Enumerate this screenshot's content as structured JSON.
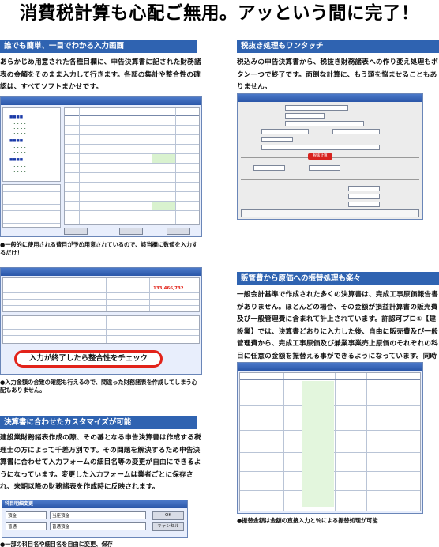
{
  "headline": "消費税計算も心配ご無用。アッという間に完了！",
  "sections": {
    "input": {
      "heading": "誰でも簡単、一目でわかる入力画面",
      "body": "あらかじめ用意された各種目欄に、申告決算書に記された財務諸表の金額をそのまま入力して行きます。各部の集計や整合性の確認は、すべてソフトまかせです。",
      "note": "●一般的に使用される費目が予め用意されているので、該当欄に数値を入力するだけ！"
    },
    "check": {
      "callout": "入力が終了したら整合性をチェック",
      "note": "●入力金額の合致の確認も行えるので、間違った財務諸表を作成してしまう心配もありません。",
      "amount": "133,466,732"
    },
    "customize": {
      "heading": "決算書に合わせたカスタマイズが可能",
      "body": "建設業財務諸表作成の際、その基となる申告決算書は作成する税理士の方によって千差万別です。その問題を解決するため申告決算書に合わせて入力フォームの細目名等の変更が自由にできるようになっています。変更した入力フォームは業者ごとに保存され、来期以降の財務諸表を作成時に反映されます。",
      "note": "●一部の科目名や細目名を自由に変更、保存",
      "dialog_title": "科目明細変更",
      "row1_label": "預金",
      "row1_value": "当座預金",
      "row2_label": "普通",
      "row2_value": "普通預金",
      "ok": "OK",
      "cancel": "キャンセル"
    },
    "tax": {
      "heading": "税抜き処理もワンタッチ",
      "body": "税込みの申告決算書から、税抜き財務諸表への作り変え処理もボタン一つで終了です。面倒な計算に、もう頭を悩ませることもありません。",
      "button": "税抜計算"
    },
    "transfer": {
      "heading": "販管費から原価への振替処理も楽々",
      "body": "一般会計基準で作成された多くの決算書は、完成工事原価報告書がありません。ほとんどの場合、その金額が損益計算書の販売費及び一般管理費に含まれて計上されています。許認可プロ①【建設業】では、決算書どおりに入力した後、自由に販売費及び一般管理費から、完成工事原価及び兼業事業売上原価のそれぞれの科目に任意の金額を振替える事ができるようになっています。同時に相対する科目間同士の金額の相殺処理も行います。",
      "note": "●振替金額は金額の直接入力と％による振替処理が可能"
    }
  },
  "colors": {
    "heading_bar": "#2f63b1",
    "callout_border": "#e2231a",
    "window_title": "#2a56a8"
  }
}
